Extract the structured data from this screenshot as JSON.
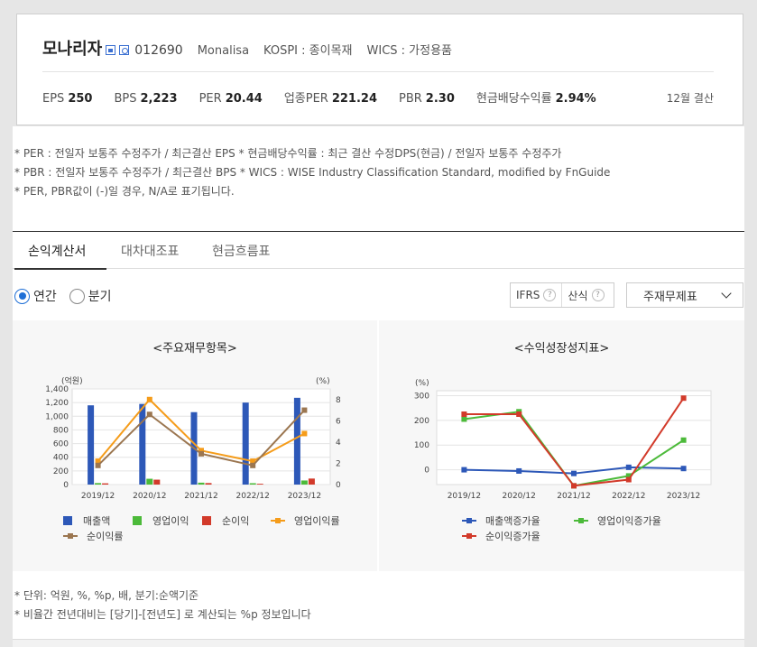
{
  "header": {
    "company_name": "모나리자",
    "code": "012690",
    "english_name": "Monalisa",
    "market": "KOSPI : 종이목재",
    "wics": "WICS : 가정용품",
    "icons": [
      "home-icon",
      "building-icon"
    ]
  },
  "metrics": [
    {
      "label": "EPS",
      "value": "250"
    },
    {
      "label": "BPS",
      "value": "2,223"
    },
    {
      "label": "PER",
      "value": "20.44"
    },
    {
      "label": "업종PER",
      "value": "221.24"
    },
    {
      "label": "PBR",
      "value": "2.30"
    },
    {
      "label": "현금배당수익률",
      "value": "2.94%"
    }
  ],
  "settlement": "12월 결산",
  "notes": [
    "* PER : 전일자 보통주 수정주가 / 최근결산 EPS * 현금배당수익률 : 최근 결산 수정DPS(현금) / 전일자 보통주 수정주가",
    "* PBR : 전일자 보통주 수정주가 / 최근결산 BPS * WICS : WISE Industry Classification Standard, modified by FnGuide",
    "* PER, PBR값이 (-)일 경우, N/A로 표기됩니다."
  ],
  "tabs": [
    {
      "label": "손익계산서",
      "active": true
    },
    {
      "label": "대차대조표",
      "active": false
    },
    {
      "label": "현금흐름표",
      "active": false
    }
  ],
  "period": {
    "annual": "연간",
    "quarter": "분기",
    "selected": "연간"
  },
  "options": {
    "ifrs": "IFRS",
    "calc": "산식",
    "help": "?"
  },
  "select": {
    "value": "주재무제표"
  },
  "colors": {
    "sales": "#2d58b8",
    "op_income": "#4cba3a",
    "net_income": "#d23a2a",
    "op_margin": "#f59c1a",
    "net_margin": "#9b7650"
  },
  "chart_data": [
    {
      "type": "bar",
      "title": "<주요재무항목>",
      "ylabel": "(억원)",
      "y2label": "(%)",
      "categories": [
        "2019/12",
        "2020/12",
        "2021/12",
        "2022/12",
        "2023/12"
      ],
      "ylim": [
        0,
        1400
      ],
      "yticks": [
        "0",
        "200",
        "400",
        "600",
        "800",
        "1,000",
        "1,200",
        "1,400"
      ],
      "y2lim": [
        0,
        9
      ],
      "y2ticks": [
        "0",
        "2",
        "4",
        "6",
        "8"
      ],
      "grid": true,
      "legend_position": "bottom",
      "series": [
        {
          "name": "매출액",
          "kind": "bar",
          "axis": "left",
          "values": [
            1160,
            1180,
            1060,
            1200,
            1270
          ]
        },
        {
          "name": "영업이익",
          "kind": "bar",
          "axis": "left",
          "values": [
            22,
            85,
            28,
            20,
            60
          ]
        },
        {
          "name": "순이익",
          "kind": "bar",
          "axis": "left",
          "values": [
            18,
            72,
            22,
            12,
            88
          ]
        },
        {
          "name": "영업이익률",
          "kind": "line",
          "axis": "right",
          "values": [
            2.2,
            8.0,
            3.2,
            2.2,
            4.8
          ]
        },
        {
          "name": "순이익률",
          "kind": "line",
          "axis": "right",
          "values": [
            1.8,
            6.6,
            2.9,
            1.8,
            7.0
          ]
        }
      ]
    },
    {
      "type": "line",
      "title": "<수익성장성지표>",
      "ylabel": "(%)",
      "categories": [
        "2019/12",
        "2020/12",
        "2021/12",
        "2022/12",
        "2023/12"
      ],
      "ylim": [
        -60,
        320
      ],
      "yticks": [
        "0",
        "100",
        "200",
        "300"
      ],
      "grid": true,
      "legend_position": "bottom",
      "series": [
        {
          "name": "매출액증가율",
          "values": [
            0,
            -5,
            -15,
            10,
            5
          ]
        },
        {
          "name": "영업이익증가율",
          "values": [
            205,
            235,
            -65,
            -25,
            120
          ]
        },
        {
          "name": "순이익증가율",
          "values": [
            225,
            225,
            -65,
            -40,
            290
          ]
        }
      ]
    }
  ],
  "footer_notes": [
    "* 단위: 억원, %, %p, 배, 분기:순액기준",
    "* 비율간 전년대비는 [당기]-[전년도] 로 계산되는 %p 정보입니다"
  ]
}
